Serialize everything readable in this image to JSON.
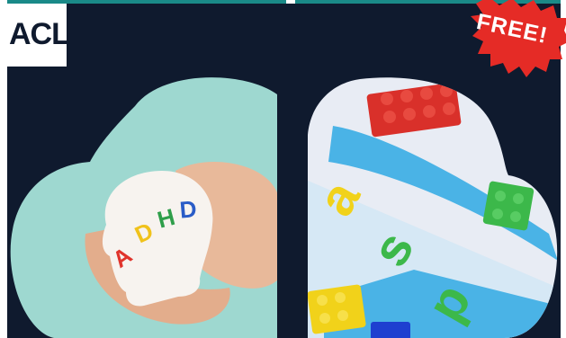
{
  "brand": {
    "logo_text": "ACL"
  },
  "badge": {
    "text": "FREE!"
  },
  "left_panel": {
    "head_text": "ADHD",
    "colors": {
      "bg": "#9ed8d0",
      "card": "#f7f3ef",
      "hand": "#e8b99a"
    }
  },
  "right_panel": {
    "letters": [
      "a",
      "s",
      "p"
    ],
    "colors": {
      "bg": "#e8ecf4",
      "ribbon": "#4ab3e6",
      "red": "#d9302a",
      "green": "#3cb84a",
      "yellow": "#f1d21a",
      "blue": "#1e3fd0"
    }
  },
  "colors": {
    "background": "#0f1a2e",
    "accent_bar": "#1a8a88",
    "badge": "#e52b26"
  }
}
